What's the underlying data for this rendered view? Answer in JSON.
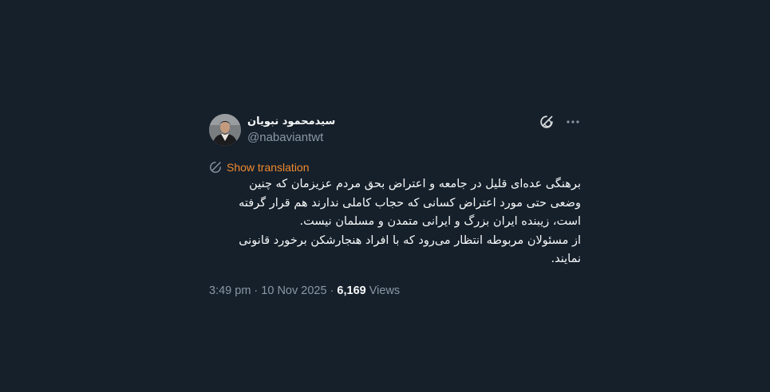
{
  "author": {
    "display_name": "سیدمحمود نبویان",
    "handle": "@nabaviantwt"
  },
  "header_actions": {
    "grok_icon": "grok-icon",
    "more_icon": "more-icon"
  },
  "translate": {
    "label": "Show translation",
    "icon": "translate-icon"
  },
  "tweet_text": {
    "line1": "برهنگی عده‌ای قلیل در جامعه و اعتراض بحق مردم عزیزمان که چنین",
    "line2": "وضعی حتی مورد اعتراض کسانی که حجاب کاملی ندارند هم قرار گرفته",
    "line3": "است، زیبنده ایران بزرگ و  ایرانی متمدن و مسلمان نیست.",
    "line4": "از مسئولان مربوطه انتظار می‌رود که  با افراد هنجارشکن برخورد قانونی",
    "line5": "نمایند."
  },
  "meta": {
    "time": "3:49 pm",
    "sep1": " · ",
    "date": "10 Nov 2025",
    "sep2": " · ",
    "views_count": "6,169",
    "views_label": " Views"
  },
  "colors": {
    "background": "#15202b",
    "text": "#f7f9f9",
    "secondary": "#8b98a5",
    "translate_accent": "#f28a2e"
  }
}
